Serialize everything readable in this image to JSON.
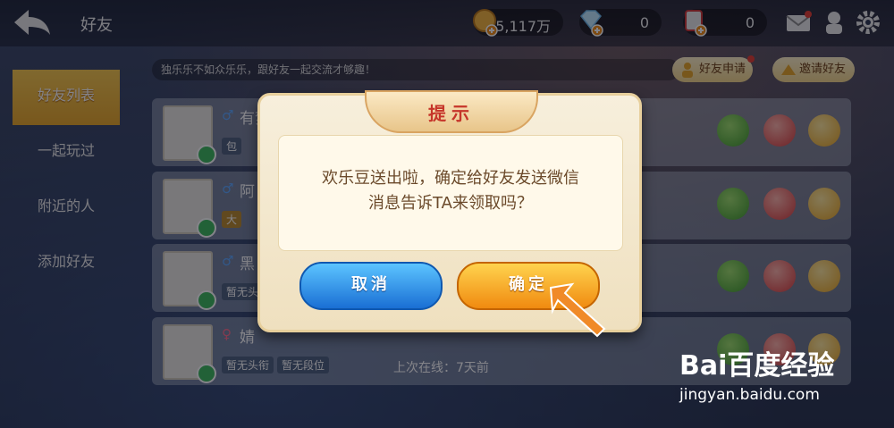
{
  "header": {
    "title": "好友",
    "gold": "5,117万",
    "diamond": "0",
    "ticket": "0"
  },
  "menu": [
    {
      "label": "好友列表"
    },
    {
      "label": "一起玩过"
    },
    {
      "label": "附近的人"
    },
    {
      "label": "添加好友"
    }
  ],
  "banner": "独乐乐不如众乐乐，跟好友一起交流才够趣！",
  "actions": {
    "requests": "好友申请",
    "invite": "邀请好友"
  },
  "friends": [
    {
      "gender": "♂",
      "name": "有梦",
      "tags": [
        "包"
      ],
      "last": ""
    },
    {
      "gender": "♂",
      "name": "阿",
      "tags": [
        "大"
      ],
      "last": ""
    },
    {
      "gender": "♂",
      "name": "黑",
      "tags": [
        "暂无头"
      ],
      "last": ""
    },
    {
      "gender": "♀",
      "name": "婧",
      "tags": [
        "暂无头衔",
        "暂无段位"
      ],
      "last": "上次在线：7天前"
    }
  ],
  "dialog": {
    "title": "提示",
    "line1": "欢乐豆送出啦，确定给好友发送微信",
    "line2": "消息告诉TA来领取吗？",
    "cancel": "取消",
    "confirm": "确定"
  },
  "watermark": {
    "logo": "Bai百度经验",
    "url": "jingyan.baidu.com"
  }
}
